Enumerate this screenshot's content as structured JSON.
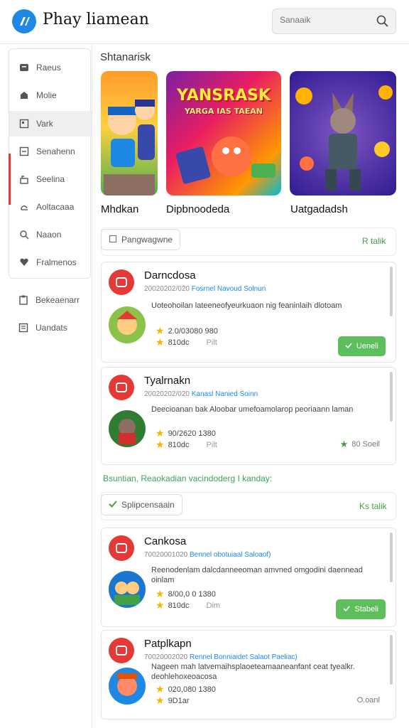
{
  "header": {
    "app_title": "Phay liamean",
    "logo_icon": "app-logo-icon",
    "search_placeholder": "Sanaaik",
    "search_icon": "search-icon"
  },
  "sidebar": {
    "groups": [
      {
        "items": [
          {
            "label": "Raeus",
            "icon": "grid-icon"
          },
          {
            "label": "Molie",
            "icon": "puzzle-icon"
          },
          {
            "label": "Vark",
            "icon": "box-icon",
            "active": true
          },
          {
            "label": "Senahenn",
            "icon": "list-icon"
          },
          {
            "label": "Seelina",
            "icon": "lock-icon"
          },
          {
            "label": "Aoltacaaa",
            "icon": "cloud-icon"
          },
          {
            "label": "Naaon",
            "icon": "search-icon"
          },
          {
            "label": "Fralmenos",
            "icon": "heart-icon"
          }
        ]
      },
      {
        "items": [
          {
            "label": "Bekeaenarr",
            "icon": "clipboard-icon"
          },
          {
            "label": "Uandats",
            "icon": "document-icon"
          }
        ]
      }
    ]
  },
  "featured": {
    "section_title": "Shtanarisk",
    "items": [
      {
        "label": "Mhdkan"
      },
      {
        "label": "Dipbnoodeda",
        "banner": "YANSRASK",
        "banner_sub": "YARGA IAS TAEAN"
      },
      {
        "label": "Uatgadadsh"
      }
    ]
  },
  "filter_bar_1": {
    "pill_label": "Pangwagwne",
    "link_label": "R talik"
  },
  "cards_1": [
    {
      "title": "Darncdosa",
      "date": "20020202/020",
      "tag": "Fosrnel Navoud Solnun",
      "description": "Uoteohoilan lateeneofyeurkuaon nig feaninlaih dlotoam",
      "rating": "2.0/03080 980",
      "downloads": "810dc",
      "size": "Pilt",
      "action": "Ueneli"
    },
    {
      "title": "Tyalrnakn",
      "date": "20020202/020",
      "tag": "Kanasl Nanied Soinn",
      "description": "Deecioanan bak Aloobar umefoamolarop peoriaann laman",
      "rating": "90/2620 1380",
      "downloads": "810dc",
      "size": "Pilt",
      "footer": "80 Soeil"
    }
  ],
  "section_subtitle": "Bsuntian, Reaokadian vacindoderg I kanday:",
  "filter_bar_2": {
    "pill_label": "Splipcensaain",
    "link_label": "Ks talik"
  },
  "cards_2": [
    {
      "title": "Cankosa",
      "date": "70020001020",
      "tag": "Bennel obotuiaal Saloaof)",
      "description": "Reenodenlam dalcdanneeoman amvned omgodini daennead oinlam",
      "rating": "8/00,0 0 1380",
      "downloads": "810dc",
      "size": "Dim",
      "action": "Stabeli"
    },
    {
      "title": "Patplkapn",
      "date": "70020002020",
      "tag": "Rennel Bonniaidet Salaot Paeliac)",
      "description": "Nageen mah latvemaihsplaoeteamaaneanfant ceat tyealkr. deohlehoxeoacosa",
      "rating": "020,080 1380",
      "downloads": "9D1ar",
      "footer": "O.oanl"
    }
  ],
  "colors": {
    "accent": "#1e88e5",
    "red": "#e53935",
    "green": "#43a047",
    "star": "#f4b400"
  }
}
